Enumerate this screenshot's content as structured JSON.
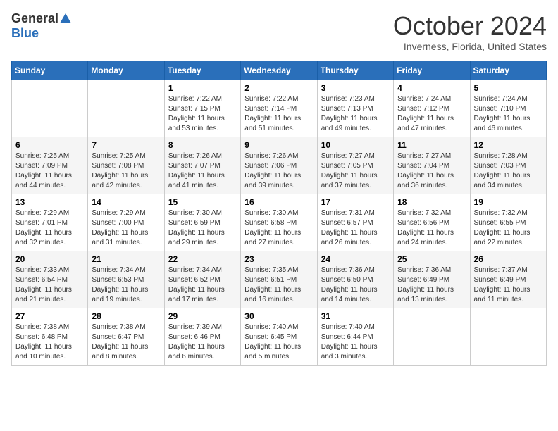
{
  "logo": {
    "general": "General",
    "blue": "Blue"
  },
  "header": {
    "title": "October 2024",
    "location": "Inverness, Florida, United States"
  },
  "weekdays": [
    "Sunday",
    "Monday",
    "Tuesday",
    "Wednesday",
    "Thursday",
    "Friday",
    "Saturday"
  ],
  "weeks": [
    [
      {
        "day": "",
        "info": ""
      },
      {
        "day": "",
        "info": ""
      },
      {
        "day": "1",
        "info": "Sunrise: 7:22 AM\nSunset: 7:15 PM\nDaylight: 11 hours and 53 minutes."
      },
      {
        "day": "2",
        "info": "Sunrise: 7:22 AM\nSunset: 7:14 PM\nDaylight: 11 hours and 51 minutes."
      },
      {
        "day": "3",
        "info": "Sunrise: 7:23 AM\nSunset: 7:13 PM\nDaylight: 11 hours and 49 minutes."
      },
      {
        "day": "4",
        "info": "Sunrise: 7:24 AM\nSunset: 7:12 PM\nDaylight: 11 hours and 47 minutes."
      },
      {
        "day": "5",
        "info": "Sunrise: 7:24 AM\nSunset: 7:10 PM\nDaylight: 11 hours and 46 minutes."
      }
    ],
    [
      {
        "day": "6",
        "info": "Sunrise: 7:25 AM\nSunset: 7:09 PM\nDaylight: 11 hours and 44 minutes."
      },
      {
        "day": "7",
        "info": "Sunrise: 7:25 AM\nSunset: 7:08 PM\nDaylight: 11 hours and 42 minutes."
      },
      {
        "day": "8",
        "info": "Sunrise: 7:26 AM\nSunset: 7:07 PM\nDaylight: 11 hours and 41 minutes."
      },
      {
        "day": "9",
        "info": "Sunrise: 7:26 AM\nSunset: 7:06 PM\nDaylight: 11 hours and 39 minutes."
      },
      {
        "day": "10",
        "info": "Sunrise: 7:27 AM\nSunset: 7:05 PM\nDaylight: 11 hours and 37 minutes."
      },
      {
        "day": "11",
        "info": "Sunrise: 7:27 AM\nSunset: 7:04 PM\nDaylight: 11 hours and 36 minutes."
      },
      {
        "day": "12",
        "info": "Sunrise: 7:28 AM\nSunset: 7:03 PM\nDaylight: 11 hours and 34 minutes."
      }
    ],
    [
      {
        "day": "13",
        "info": "Sunrise: 7:29 AM\nSunset: 7:01 PM\nDaylight: 11 hours and 32 minutes."
      },
      {
        "day": "14",
        "info": "Sunrise: 7:29 AM\nSunset: 7:00 PM\nDaylight: 11 hours and 31 minutes."
      },
      {
        "day": "15",
        "info": "Sunrise: 7:30 AM\nSunset: 6:59 PM\nDaylight: 11 hours and 29 minutes."
      },
      {
        "day": "16",
        "info": "Sunrise: 7:30 AM\nSunset: 6:58 PM\nDaylight: 11 hours and 27 minutes."
      },
      {
        "day": "17",
        "info": "Sunrise: 7:31 AM\nSunset: 6:57 PM\nDaylight: 11 hours and 26 minutes."
      },
      {
        "day": "18",
        "info": "Sunrise: 7:32 AM\nSunset: 6:56 PM\nDaylight: 11 hours and 24 minutes."
      },
      {
        "day": "19",
        "info": "Sunrise: 7:32 AM\nSunset: 6:55 PM\nDaylight: 11 hours and 22 minutes."
      }
    ],
    [
      {
        "day": "20",
        "info": "Sunrise: 7:33 AM\nSunset: 6:54 PM\nDaylight: 11 hours and 21 minutes."
      },
      {
        "day": "21",
        "info": "Sunrise: 7:34 AM\nSunset: 6:53 PM\nDaylight: 11 hours and 19 minutes."
      },
      {
        "day": "22",
        "info": "Sunrise: 7:34 AM\nSunset: 6:52 PM\nDaylight: 11 hours and 17 minutes."
      },
      {
        "day": "23",
        "info": "Sunrise: 7:35 AM\nSunset: 6:51 PM\nDaylight: 11 hours and 16 minutes."
      },
      {
        "day": "24",
        "info": "Sunrise: 7:36 AM\nSunset: 6:50 PM\nDaylight: 11 hours and 14 minutes."
      },
      {
        "day": "25",
        "info": "Sunrise: 7:36 AM\nSunset: 6:49 PM\nDaylight: 11 hours and 13 minutes."
      },
      {
        "day": "26",
        "info": "Sunrise: 7:37 AM\nSunset: 6:49 PM\nDaylight: 11 hours and 11 minutes."
      }
    ],
    [
      {
        "day": "27",
        "info": "Sunrise: 7:38 AM\nSunset: 6:48 PM\nDaylight: 11 hours and 10 minutes."
      },
      {
        "day": "28",
        "info": "Sunrise: 7:38 AM\nSunset: 6:47 PM\nDaylight: 11 hours and 8 minutes."
      },
      {
        "day": "29",
        "info": "Sunrise: 7:39 AM\nSunset: 6:46 PM\nDaylight: 11 hours and 6 minutes."
      },
      {
        "day": "30",
        "info": "Sunrise: 7:40 AM\nSunset: 6:45 PM\nDaylight: 11 hours and 5 minutes."
      },
      {
        "day": "31",
        "info": "Sunrise: 7:40 AM\nSunset: 6:44 PM\nDaylight: 11 hours and 3 minutes."
      },
      {
        "day": "",
        "info": ""
      },
      {
        "day": "",
        "info": ""
      }
    ]
  ]
}
